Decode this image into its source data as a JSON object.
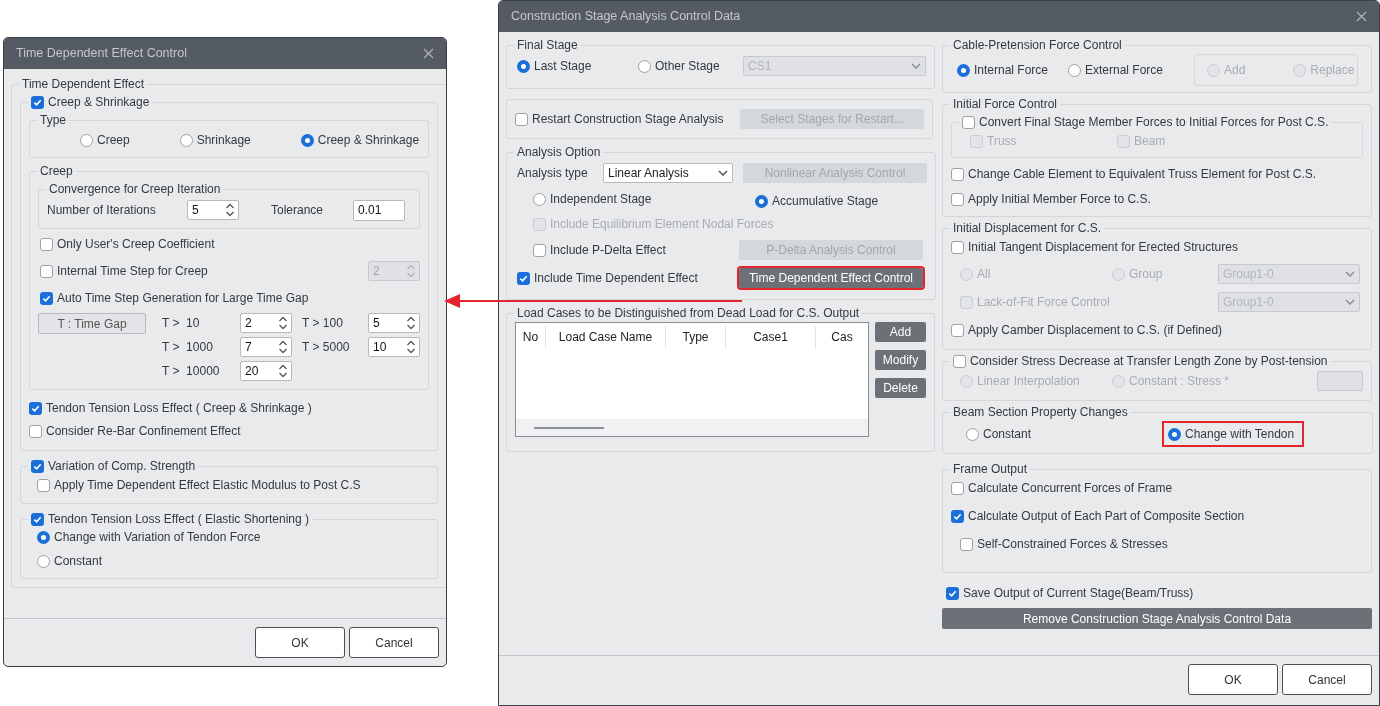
{
  "time_dependent_dialog": {
    "title": "Time Dependent Effect Control",
    "group_title": "Time Dependent Effect",
    "creep_shrinkage": {
      "label": "Creep & Shrinkage",
      "checked": true
    },
    "type": {
      "title": "Type",
      "options": [
        {
          "label": "Creep",
          "selected": false
        },
        {
          "label": "Shrinkage",
          "selected": false
        },
        {
          "label": "Creep & Shrinkage",
          "selected": true
        }
      ]
    },
    "creep": {
      "title": "Creep",
      "convergence": {
        "title": "Convergence for Creep Iteration",
        "iterations_label": "Number of Iterations",
        "iterations": "5",
        "tolerance_label": "Tolerance",
        "tolerance": "0.01"
      },
      "only_user": {
        "label": "Only User's Creep Coefficient",
        "checked": false
      },
      "internal_step": {
        "label": "Internal Time Step for Creep",
        "checked": false,
        "value": "2",
        "disabled": true
      },
      "auto_step": {
        "label": "Auto Time Step Generation for Large Time Gap",
        "checked": true
      },
      "time_gap_button": "T : Time Gap",
      "gaps": [
        {
          "label": "T >  10",
          "value": "2"
        },
        {
          "label": "T > 100",
          "value": "5"
        },
        {
          "label": "T >  1000",
          "value": "7"
        },
        {
          "label": "T > 5000",
          "value": "10"
        },
        {
          "label": "T >  10000",
          "value": "20"
        }
      ]
    },
    "tendon_loss_creep": {
      "label": "Tendon Tension Loss Effect ( Creep & Shrinkage )",
      "checked": true
    },
    "rebar": {
      "label": "Consider Re-Bar Confinement Effect",
      "checked": false
    },
    "comp_strength": {
      "label": "Variation of Comp. Strength",
      "checked": true
    },
    "apply_modulus": {
      "label": "Apply Time Dependent Effect Elastic Modulus to Post C.S",
      "checked": false
    },
    "tendon_loss_elastic": {
      "label": "Tendon Tension Loss Effect ( Elastic Shortening )",
      "checked": true
    },
    "elastic_options": [
      {
        "label": "Change with Variation of Tendon Force",
        "selected": true
      },
      {
        "label": "Constant",
        "selected": false
      }
    ],
    "buttons": [
      "OK",
      "Cancel"
    ]
  },
  "control_data_dialog": {
    "title": "Construction Stage Analysis Control Data",
    "final_stage": {
      "title": "Final Stage",
      "options": [
        {
          "label": "Last Stage",
          "selected": true
        },
        {
          "label": "Other Stage",
          "selected": false
        }
      ],
      "stage_select": {
        "value": "CS1",
        "disabled": true
      }
    },
    "restart": {
      "label": "Restart Construction Stage Analysis",
      "checked": false
    },
    "restart_button": {
      "label": "Select Stages for Restart...",
      "disabled": true
    },
    "analysis_option": {
      "title": "Analysis Option",
      "type_label": "Analysis type",
      "type_value": "Linear Analysis",
      "nonlinear_button": {
        "label": "Nonlinear Analysis Control",
        "disabled": true
      },
      "stage_options": [
        {
          "label": "Independent Stage",
          "selected": false
        },
        {
          "label": "Accumulative Stage",
          "selected": true
        }
      ],
      "equilibrium": {
        "label": "Include Equilibrium Element Nodal Forces",
        "checked": false,
        "disabled": true
      },
      "pdelta": {
        "label": "Include P-Delta Effect",
        "checked": false
      },
      "pdelta_button": {
        "label": "P-Delta Analysis Control",
        "disabled": true
      },
      "time_dependent": {
        "label": "Include Time Dependent Effect",
        "checked": true
      },
      "time_dependent_button": {
        "label": "Time Dependent Effect Control",
        "disabled": false,
        "highlighted": true
      }
    },
    "load_cases": {
      "title": "Load Cases to be Distinguished from Dead Load for C.S. Output",
      "columns": [
        "No",
        "Load Case Name",
        "Type",
        "Case1",
        "Cas"
      ],
      "buttons": [
        "Add",
        "Modify",
        "Delete"
      ]
    },
    "cable": {
      "title": "Cable-Pretension Force Control",
      "options": [
        {
          "label": "Internal Force",
          "selected": true
        },
        {
          "label": "External Force",
          "selected": false
        }
      ],
      "sub_options": [
        {
          "label": "Add",
          "selected": false,
          "disabled": true
        },
        {
          "label": "Replace",
          "selected": false,
          "disabled": true
        }
      ]
    },
    "initial_force": {
      "title": "Initial Force Control",
      "convert": {
        "label": "Convert Final Stage Member Forces to Initial Forces for Post C.S.",
        "checked": false
      },
      "members": [
        {
          "label": "Truss",
          "checked": false,
          "disabled": true
        },
        {
          "label": "Beam",
          "checked": false,
          "disabled": true
        }
      ],
      "change_cable": {
        "label": "Change Cable Element to Equivalent Truss Element for Post C.S.",
        "checked": false
      },
      "apply_initial": {
        "label": "Apply Initial Member Force to C.S.",
        "checked": false
      }
    },
    "initial_displacement": {
      "title": "Initial Displacement for C.S.",
      "tangent": {
        "label": "Initial Tangent Displacement for Erected Structures",
        "checked": false
      },
      "scope": [
        {
          "label": "All",
          "selected": false,
          "disabled": true
        },
        {
          "label": "Group",
          "selected": false,
          "disabled": true
        }
      ],
      "group_select": {
        "value": "Group1-0",
        "disabled": true
      },
      "lack_of_fit": {
        "label": "Lack-of-Fit Force Control",
        "checked": false,
        "disabled": true
      },
      "lack_select": {
        "value": "Group1-0",
        "disabled": true
      },
      "camber": {
        "label": "Apply Camber Displacement to C.S. (if Defined)",
        "checked": false
      }
    },
    "stress_decrease": {
      "label": "Consider Stress Decrease at Transfer Length Zone by Post-tension",
      "checked": false,
      "options": [
        {
          "label": "Linear Interpolation",
          "selected": false,
          "disabled": true
        },
        {
          "label": "Constant : Stress *",
          "selected": false,
          "disabled": true
        }
      ]
    },
    "beam_section": {
      "title": "Beam Section Property Changes",
      "options": [
        {
          "label": "Constant",
          "selected": false
        },
        {
          "label": "Change with Tendon",
          "selected": true,
          "highlighted": true
        }
      ]
    },
    "frame_output": {
      "title": "Frame Output",
      "items": [
        {
          "label": "Calculate Concurrent Forces of Frame",
          "checked": false
        },
        {
          "label": "Calculate Output of Each Part of Composite Section",
          "checked": true
        },
        {
          "label": "Self-Constrained Forces & Stresses",
          "checked": false
        }
      ]
    },
    "save_output": {
      "label": "Save Output of Current Stage(Beam/Truss)",
      "checked": true
    },
    "remove_button": "Remove Construction Stage Analysis Control Data",
    "buttons": [
      "OK",
      "Cancel"
    ]
  }
}
